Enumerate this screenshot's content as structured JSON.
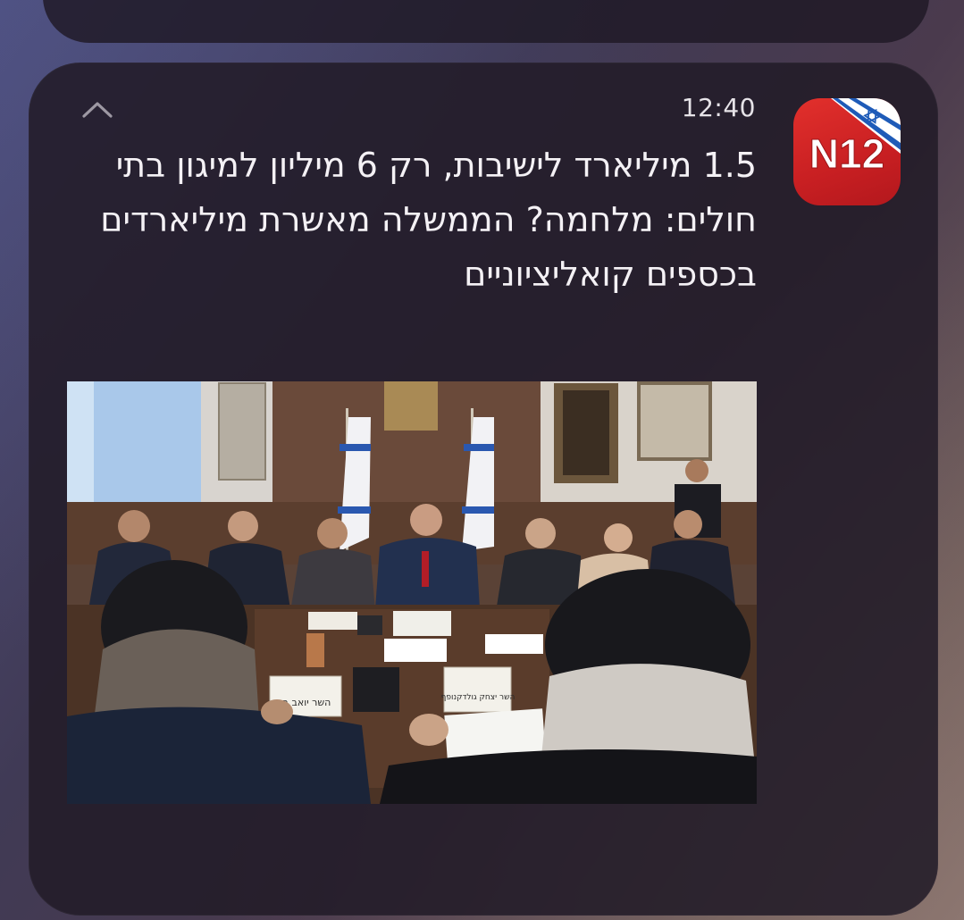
{
  "notification": {
    "app_name": "N12",
    "time": "12:40",
    "headline": "1.5 מיליארד לישיבות, רק 6 מיליון למיגון בתי חולים: מלחמה? הממשלה מאשרת מיליארדים בכספים קואליציוניים",
    "image": {
      "placards": {
        "left": "השר יואב בן",
        "center": "השר יצחק גולדקנופף"
      }
    }
  },
  "icons": {
    "collapse": "chevron-up-icon",
    "app": "n12-logo-icon"
  },
  "colors": {
    "card_background": "#221b28",
    "text_primary": "#f4f1f5",
    "app_icon_red": "#d3262a"
  }
}
